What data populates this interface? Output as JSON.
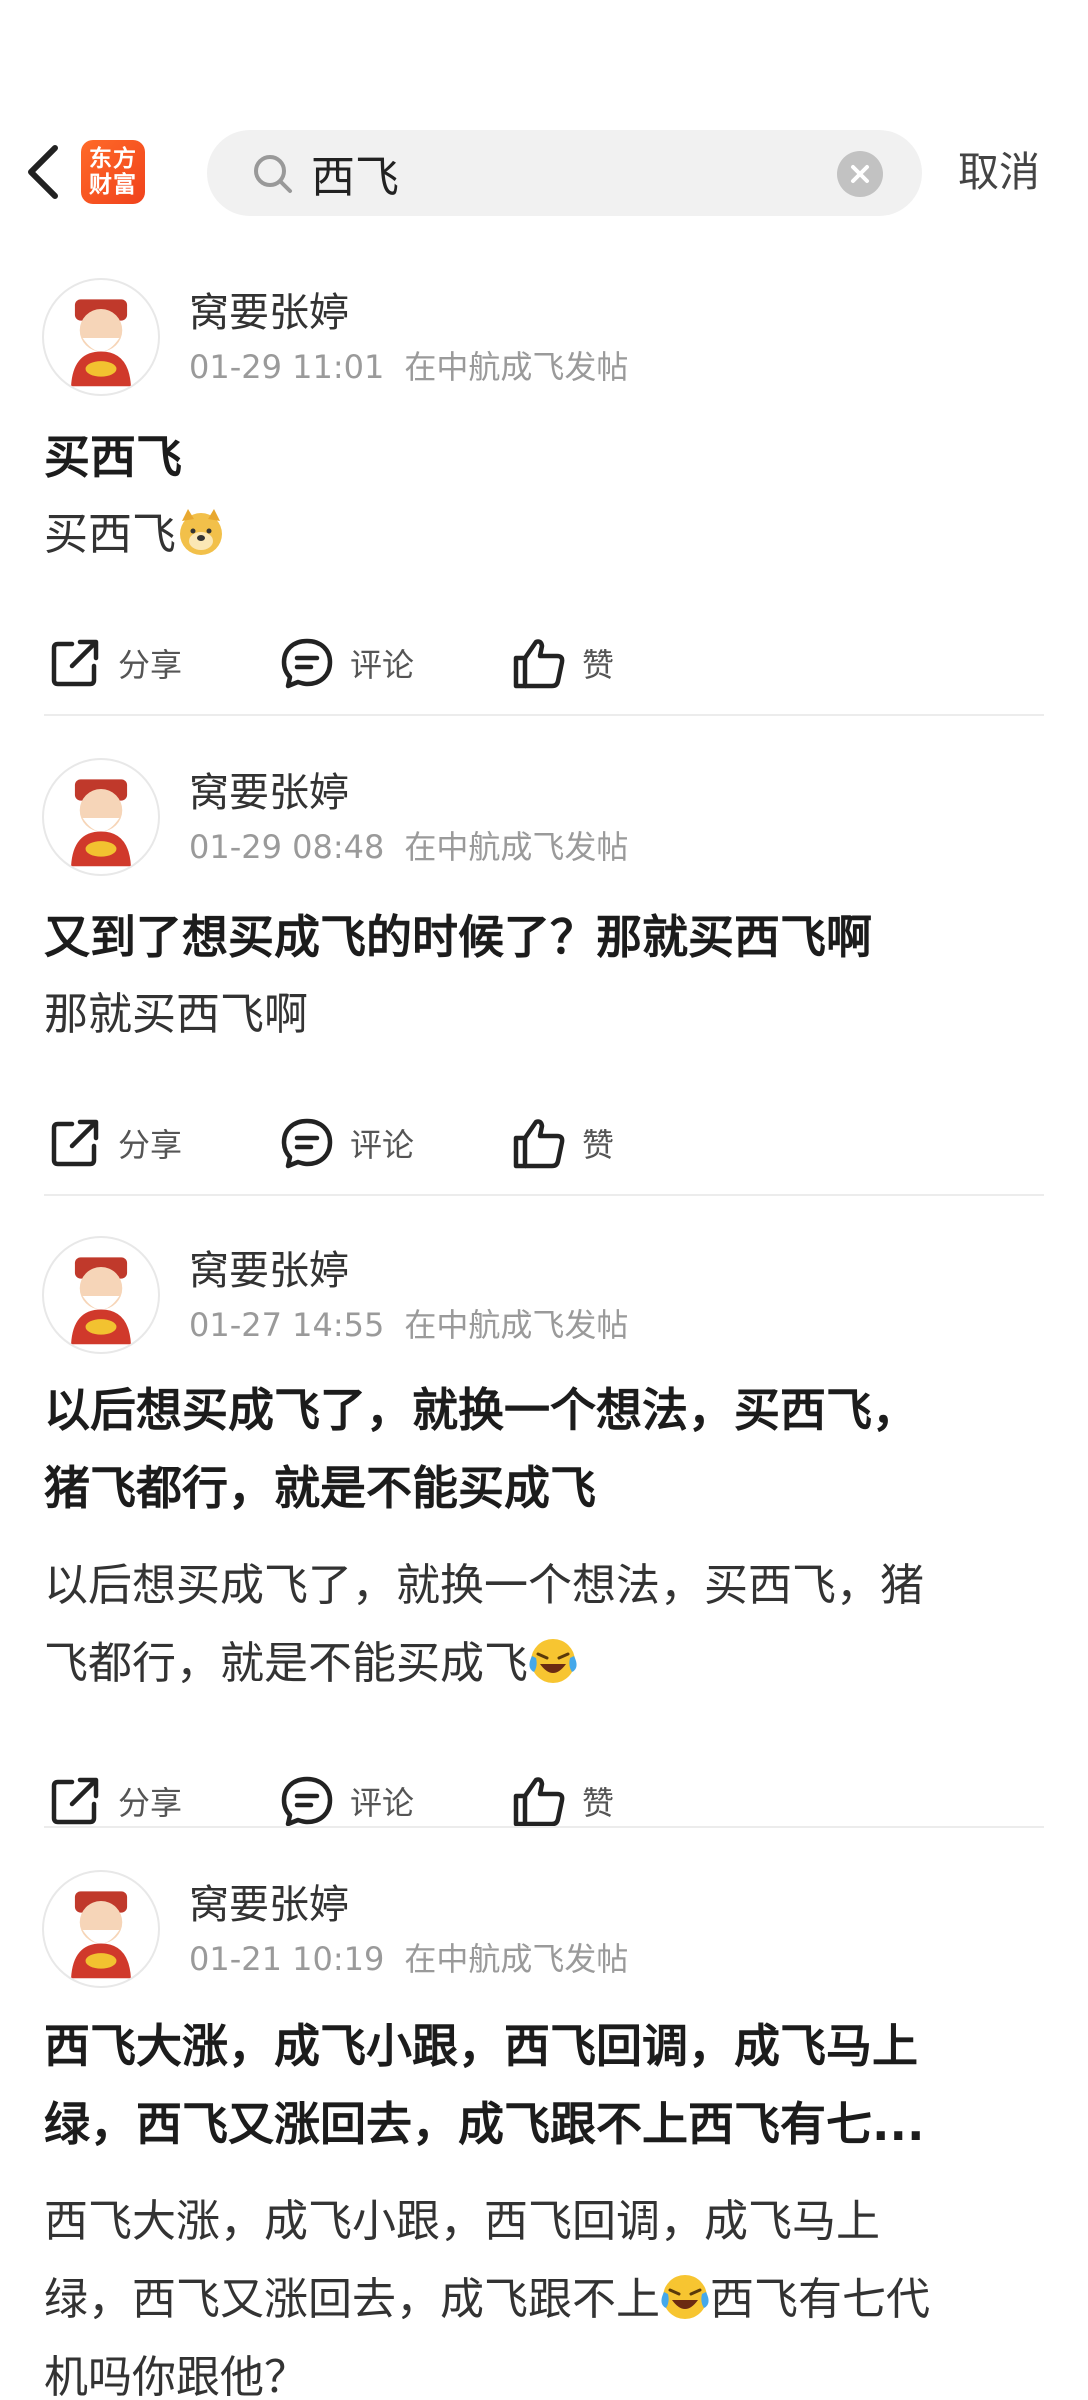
{
  "header": {
    "logo_line1": "东方",
    "logo_line2": "财富",
    "search_value": "西飞",
    "cancel_label": "取消"
  },
  "actions": {
    "share": "分享",
    "comment": "评论",
    "like": "赞"
  },
  "posts": [
    {
      "author": "窝要张婷",
      "date": "01-29 11:01",
      "location": "在中航成飞发帖",
      "title": "买西飞",
      "body": "买西飞"
    },
    {
      "author": "窝要张婷",
      "date": "01-29 08:48",
      "location": "在中航成飞发帖",
      "title": "又到了想买成飞的时候了？那就买西飞啊",
      "body": "那就买西飞啊"
    },
    {
      "author": "窝要张婷",
      "date": "01-27 14:55",
      "location": "在中航成飞发帖",
      "title_line1": "以后想买成飞了，就换一个想法，买西飞，",
      "title_line2": "猪飞都行，就是不能买成飞",
      "body_line1": "以后想买成飞了，就换一个想法，买西飞，猪",
      "body_line2": "飞都行，就是不能买成飞"
    },
    {
      "author": "窝要张婷",
      "date": "01-21 10:19",
      "location": "在中航成飞发帖",
      "title_line1": "西飞大涨，成飞小跟，西飞回调，成飞马上",
      "title_line2": "绿，西飞又涨回去，成飞跟不上西飞有七...",
      "body_line1": "西飞大涨，成飞小跟，西飞回调，成飞马上",
      "body_line2a": "绿，西飞又涨回去，成飞跟不上",
      "body_line2b": "西飞有七代",
      "body_line3": "机吗你跟他？"
    }
  ]
}
